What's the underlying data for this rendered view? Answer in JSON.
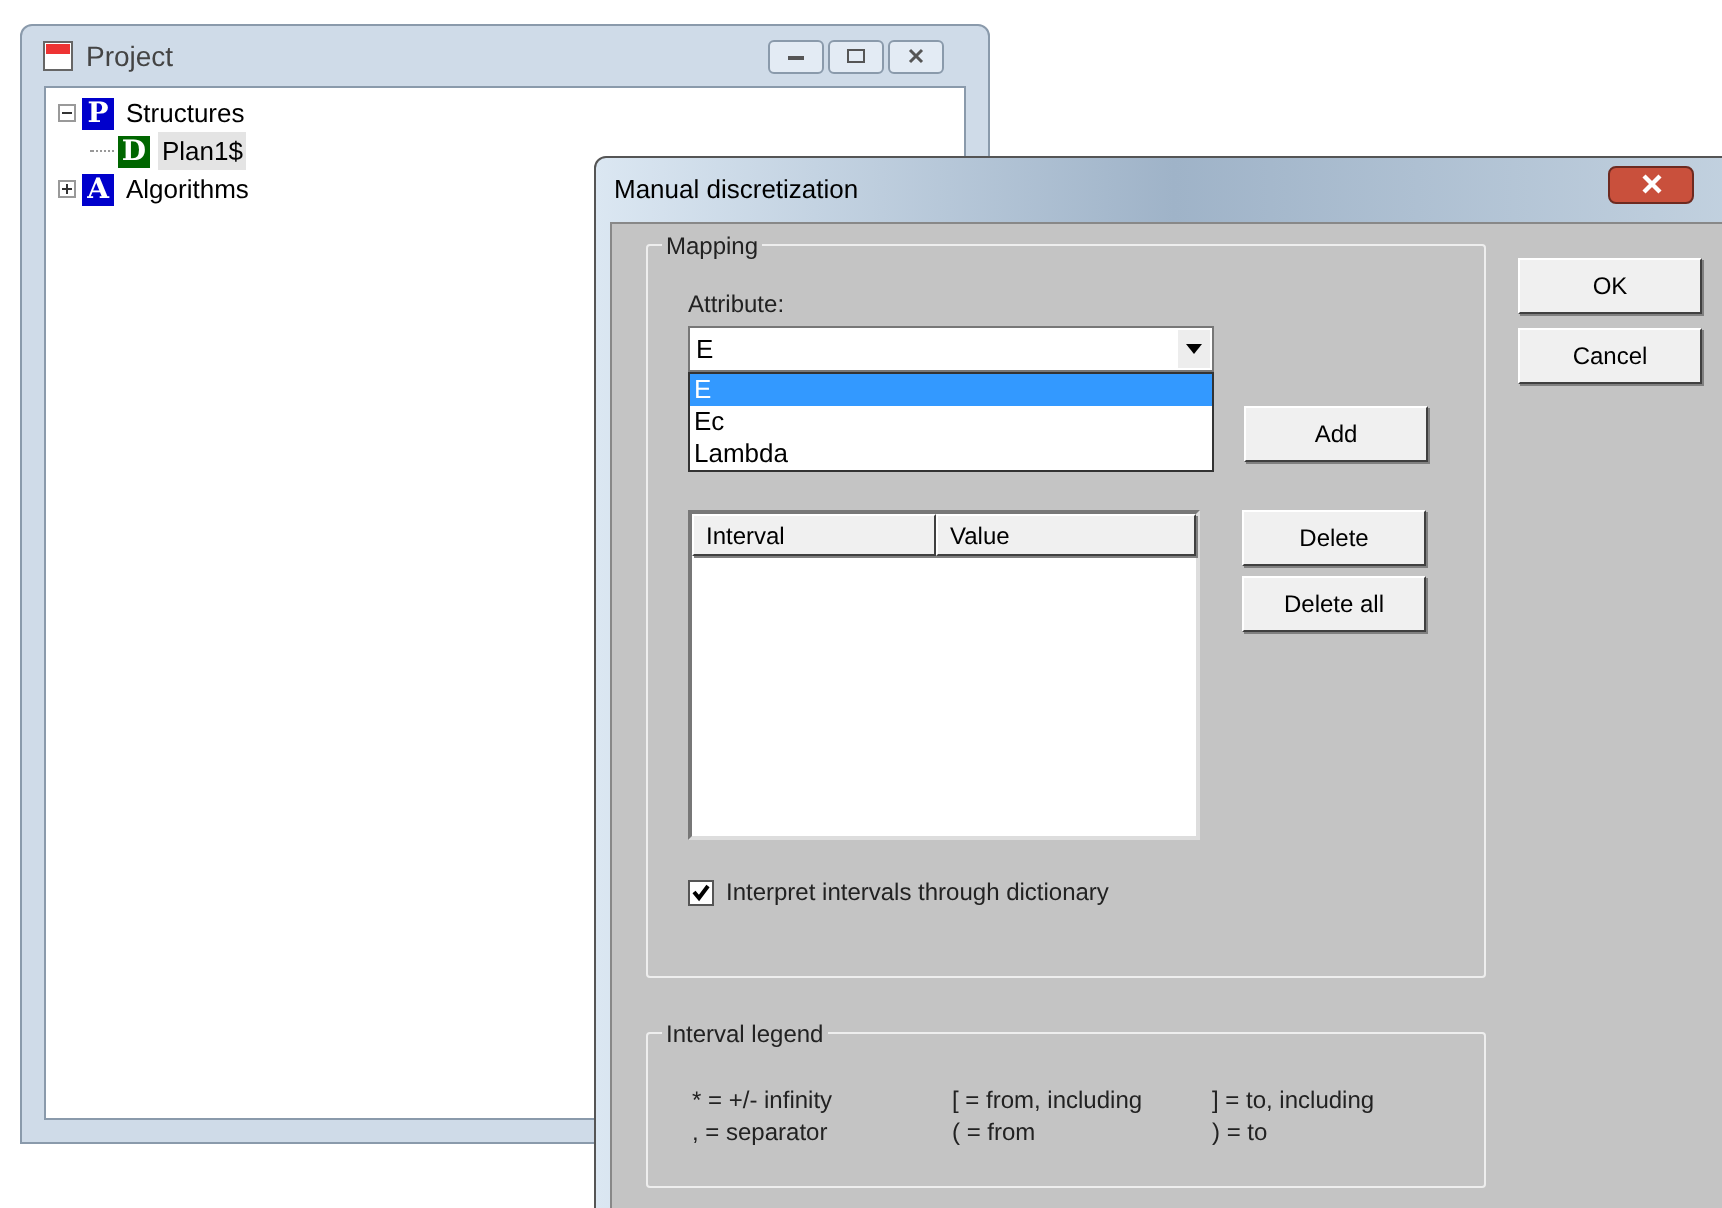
{
  "project_window": {
    "title": "Project",
    "tree": [
      {
        "label": "Structures",
        "badge": "P",
        "color": "#0000cc",
        "expanded": true,
        "selected": false,
        "children": [
          {
            "label": "Plan1$",
            "badge": "D",
            "color": "#006600",
            "selected": true
          }
        ]
      },
      {
        "label": "Algorithms",
        "badge": "A",
        "color": "#0000cc",
        "expanded": false,
        "selected": false
      }
    ]
  },
  "dialog": {
    "title": "Manual discretization",
    "mapping": {
      "label": "Mapping",
      "attribute_label": "Attribute:",
      "attribute_value": "E",
      "options": [
        {
          "label": "E",
          "selected": true
        },
        {
          "label": "Ec",
          "selected": false
        },
        {
          "label": "Lambda",
          "selected": false
        }
      ],
      "add_button": "Add",
      "table_columns": [
        "Interval",
        "Value"
      ],
      "delete_button": "Delete",
      "delete_all_button": "Delete all",
      "checkbox": {
        "label": "Interpret intervals through dictionary",
        "checked": true
      }
    },
    "legend": {
      "label": "Interval legend",
      "rows": [
        [
          "* = +/- infinity",
          "[ = from, including",
          "] = to, including"
        ],
        [
          ", = separator",
          "( = from",
          ") = to"
        ]
      ]
    },
    "buttons": [
      "OK",
      "Cancel"
    ]
  }
}
